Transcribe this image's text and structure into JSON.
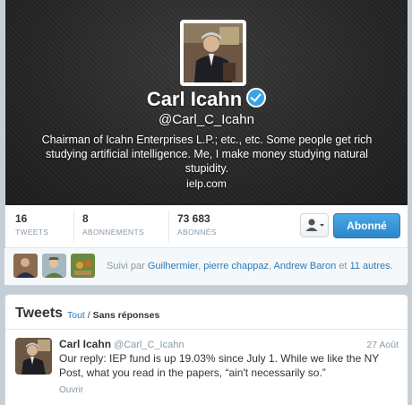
{
  "profile": {
    "name": "Carl Icahn",
    "handle": "@Carl_C_Icahn",
    "bio": "Chairman of Icahn Enterprises L.P.; etc., etc. Some people get rich studying artificial intelligence. Me, I make money studying natural stupidity.",
    "url": "ielp.com"
  },
  "stats": [
    {
      "value": "16",
      "label": "TWEETS"
    },
    {
      "value": "8",
      "label": "ABONNEMENTS"
    },
    {
      "value": "73 683",
      "label": "ABONNÉS"
    }
  ],
  "actions": {
    "follow_label": "Abonné"
  },
  "followed_by": {
    "prefix": "Suivi par",
    "names": [
      "Guilhermier",
      "pierre chappaz",
      "Andrew Baron"
    ],
    "separator": ",",
    "conjunction": "et",
    "others": "11 autres."
  },
  "tweets": {
    "title": "Tweets",
    "filter_all": "Tout",
    "filter_sep": "/",
    "filter_current": "Sans réponses",
    "items": [
      {
        "name": "Carl Icahn",
        "handle": "@Carl_C_Icahn",
        "date": "27 Août",
        "text": "Our reply: IEP fund is up 19.03% since July 1. While we like the NY Post, what you read in the papers, “ain't necessarily so.”",
        "open": "Ouvrir"
      }
    ]
  },
  "colors": {
    "accent": "#2b7bb9",
    "follow_button": "#3a9ad9",
    "verified": "#3aa3e3"
  },
  "icons": [
    "verified-badge-icon",
    "user-icon",
    "caret-down-icon"
  ]
}
